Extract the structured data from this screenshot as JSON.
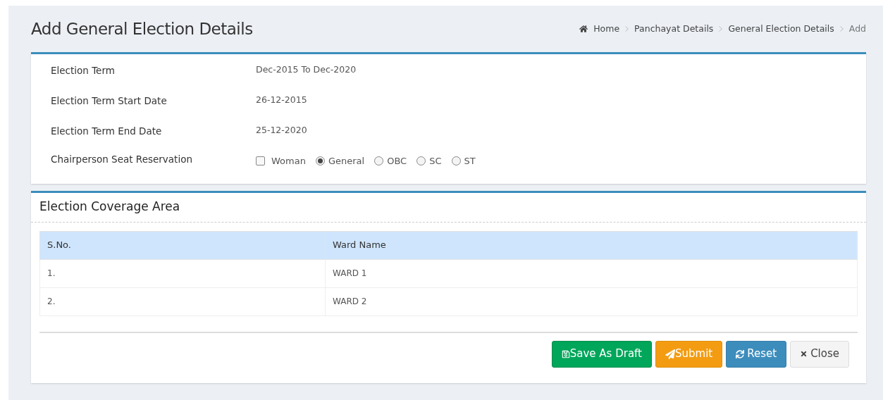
{
  "page_title": "Add General Election Details",
  "breadcrumb": [
    {
      "label": "Home",
      "kind": "home"
    },
    {
      "label": "Panchayat Details",
      "kind": "link"
    },
    {
      "label": "General Election Details",
      "kind": "link"
    },
    {
      "label": "Add",
      "kind": "current"
    }
  ],
  "details": [
    {
      "label": "Election Term",
      "value": "Dec-2015 To Dec-2020"
    },
    {
      "label": "Election Term Start Date",
      "value": "26-12-2015"
    },
    {
      "label": "Election Term End Date",
      "value": "25-12-2020"
    }
  ],
  "reservation": {
    "label": "Chairperson Seat Reservation",
    "options": [
      {
        "label": "Woman",
        "kind": "checkbox",
        "checked": false
      },
      {
        "label": "General",
        "kind": "radio",
        "selected": true
      },
      {
        "label": "OBC",
        "kind": "radio",
        "selected": false
      },
      {
        "label": "SC",
        "kind": "radio",
        "selected": false
      },
      {
        "label": "ST",
        "kind": "radio",
        "selected": false
      }
    ]
  },
  "coverage": {
    "title": "Election Coverage Area",
    "columns": [
      "S.No.",
      "Ward Name"
    ],
    "rows": [
      [
        "1.",
        "WARD 1"
      ],
      [
        "2.",
        "WARD 2"
      ]
    ]
  },
  "buttons": [
    {
      "label": "Save As Draft",
      "kind": "draft"
    },
    {
      "label": "Submit",
      "kind": "submit"
    },
    {
      "label": "Reset",
      "kind": "reset"
    },
    {
      "label": "Close",
      "kind": "close"
    }
  ]
}
